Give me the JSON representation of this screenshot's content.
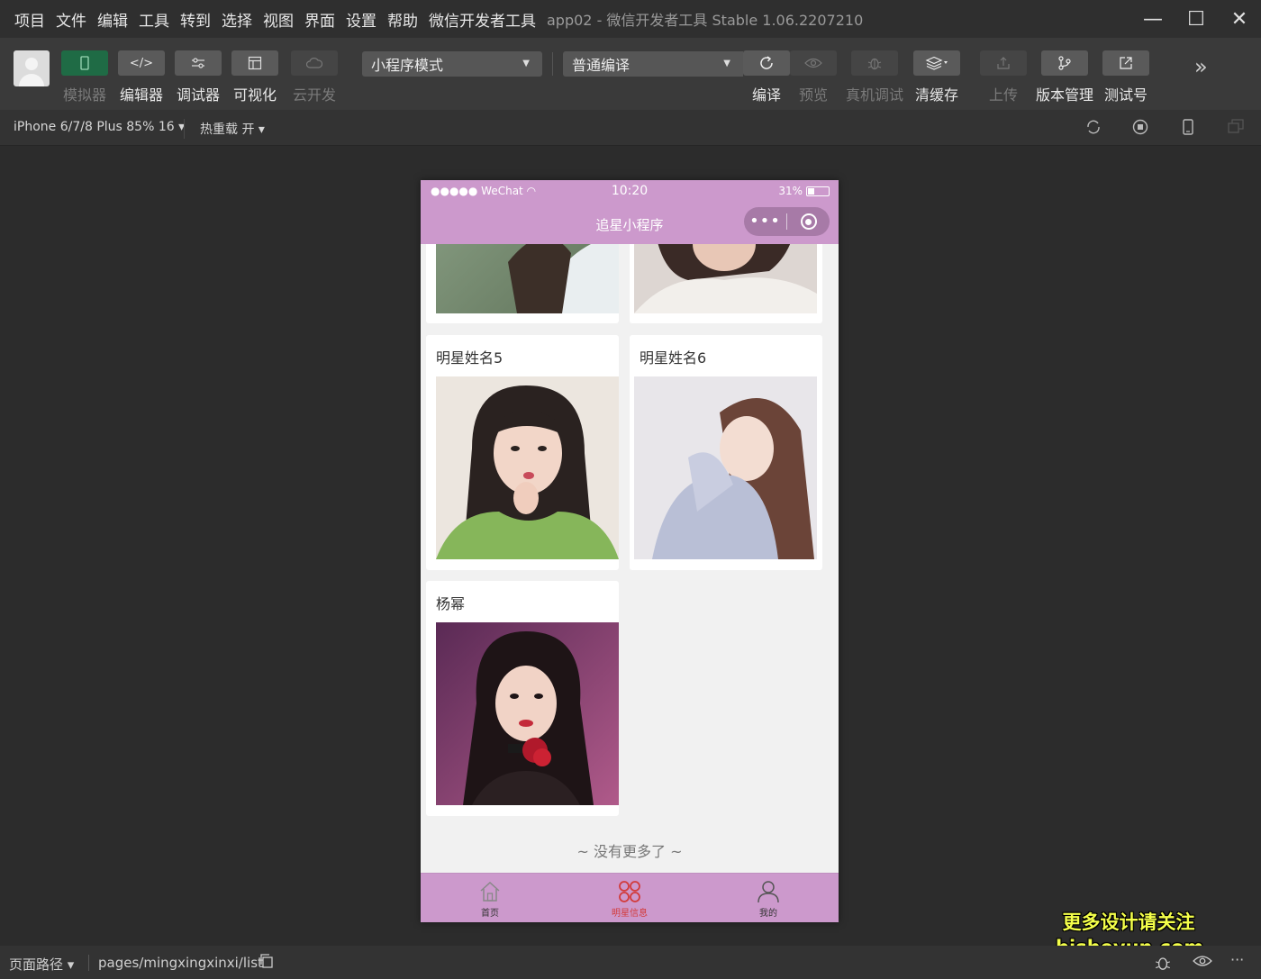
{
  "menu": {
    "items": [
      "项目",
      "文件",
      "编辑",
      "工具",
      "转到",
      "选择",
      "视图",
      "界面",
      "设置",
      "帮助",
      "微信开发者工具"
    ],
    "app_title": "app02 - 微信开发者工具 Stable 1.06.2207210"
  },
  "window_controls": {
    "minimize": "—",
    "maximize": "☐",
    "close": "✕"
  },
  "toolbar": {
    "simulator": "模拟器",
    "editor": "编辑器",
    "debugger": "调试器",
    "visual": "可视化",
    "cloud": "云开发",
    "mode_select": "小程序模式",
    "compile_select": "普通编译",
    "compile": "编译",
    "preview": "预览",
    "remote_debug": "真机调试",
    "clear_cache": "清缓存",
    "upload": "上传",
    "version": "版本管理",
    "test_account": "测试号"
  },
  "subbar": {
    "device": "iPhone 6/7/8 Plus 85% 16 ▾",
    "hot_reload": "热重载 开 ▾"
  },
  "phone": {
    "status_left": "●●●●● WeChat",
    "time": "10:20",
    "battery_text": "31%",
    "battery_level": 0.31,
    "nav_title": "追星小程序",
    "capsule_dots": "•••",
    "cards": [
      {
        "name": "明星姓名5"
      },
      {
        "name": "明星姓名6"
      },
      {
        "name": "杨幂"
      }
    ],
    "end_text": "~ 没有更多了 ~",
    "tabs": [
      {
        "label": "首页"
      },
      {
        "label": "明星信息"
      },
      {
        "label": "我的"
      }
    ],
    "colors": {
      "theme": "#cc99cc",
      "active_tab": "#d23b3b"
    }
  },
  "bottombar": {
    "path_label": "页面路径 ▾",
    "path": "pages/mingxingxinxi/list"
  },
  "watermark": {
    "line1": "更多设计请关注",
    "line2": "bisheyun.com"
  }
}
